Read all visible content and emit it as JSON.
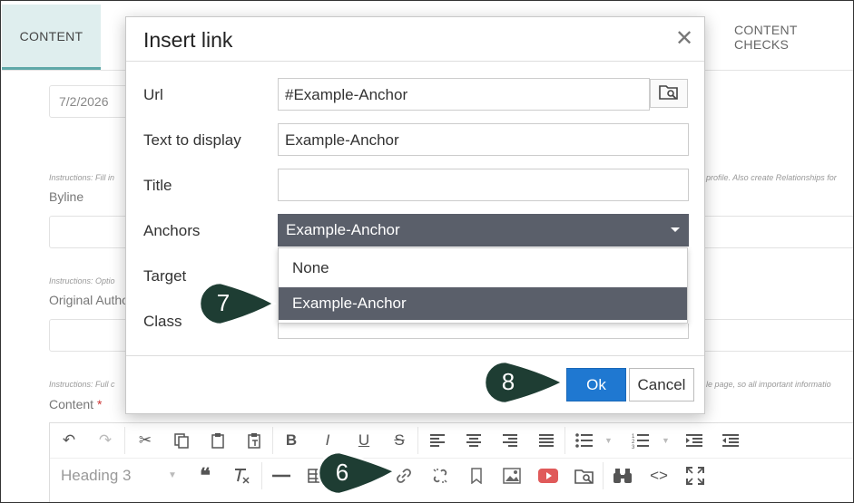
{
  "tabs": {
    "content": "CONTENT",
    "content_checks": "CONTENT CHECKS"
  },
  "form": {
    "date_value": "7/2/2026",
    "instr_byline_left": "Instructions: Fill in",
    "instr_byline_right": "profile. Also create Relationships for",
    "byline_label": "Byline",
    "instr_author": "Instructions: Optio",
    "original_author_label": "Original Autho",
    "instr_content_left": "Instructions: Full c",
    "instr_content_right": "le page, so all important informatio",
    "content_label": "Content",
    "content_required": "*"
  },
  "editor": {
    "heading_select": "Heading 3"
  },
  "dialog": {
    "title": "Insert link",
    "close_glyph": "✕",
    "url_label": "Url",
    "url_value": "#Example-Anchor",
    "text_label": "Text to display",
    "text_value": "Example-Anchor",
    "title_label": "Title",
    "title_value": "",
    "anchors_label": "Anchors",
    "anchors_value": "Example-Anchor",
    "anchors_options": [
      "None",
      "Example-Anchor"
    ],
    "target_label": "Target",
    "class_label": "Class",
    "ok_label": "Ok",
    "cancel_label": "Cancel"
  },
  "callouts": [
    "7",
    "8",
    "6"
  ],
  "colors": {
    "callout_fill": "#1e3d33",
    "ok_blue": "#1f78d1",
    "select_gray": "#5a5f6a",
    "active_tab": "#dfeeee",
    "youtube_red": "#e05a5a"
  }
}
